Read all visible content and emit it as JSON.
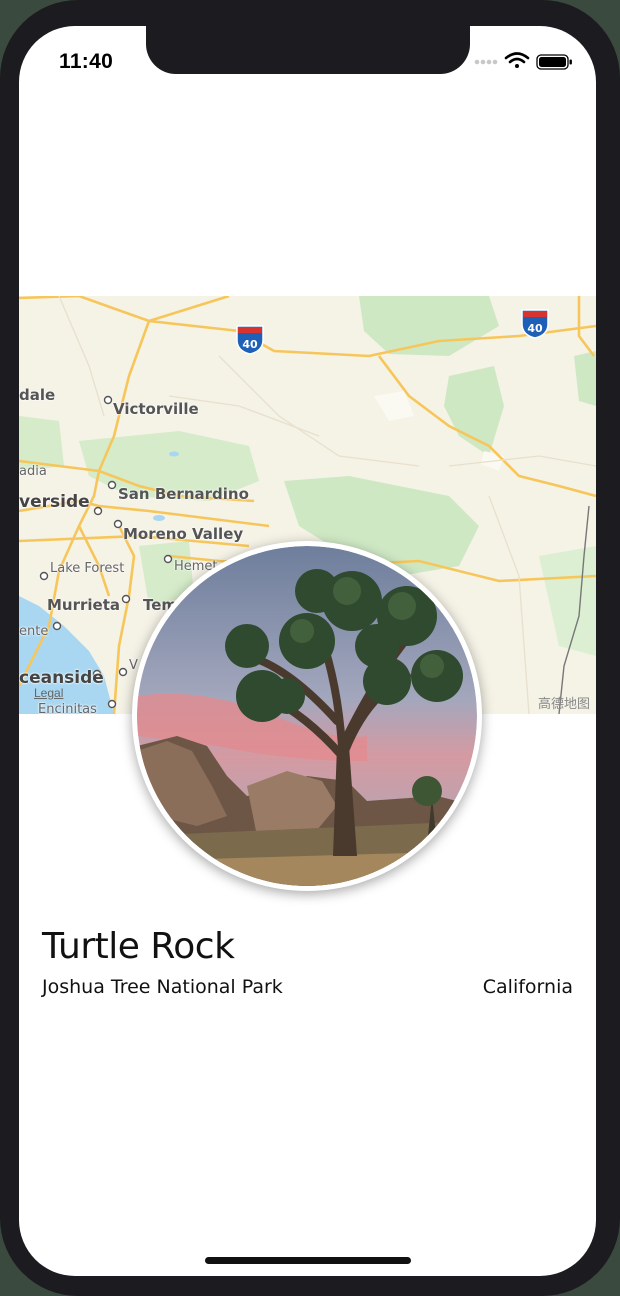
{
  "status_bar": {
    "time": "11:40",
    "icons": [
      "cellular-signal-icon",
      "wifi-icon",
      "battery-icon"
    ]
  },
  "map": {
    "place_labels": [
      "dale",
      "Victorville",
      "adia",
      "verside",
      "San Bernardino",
      "Moreno Valley",
      "Lake Forest",
      "Hemet",
      "Murrieta",
      "Tem",
      "ente",
      "ceanside",
      "V",
      "Encinitas"
    ],
    "highway_shield": "40",
    "legal_link": "Legal",
    "provider_watermark": "高德地图",
    "colors": {
      "land": "#f5f2e6",
      "park": "#cfe8c4",
      "water": "#a9d7f2",
      "road": "#f7c65a"
    }
  },
  "landmark": {
    "name": "Turtle Rock",
    "park": "Joshua Tree National Park",
    "state": "California",
    "photo": "joshua-tree-photo"
  }
}
